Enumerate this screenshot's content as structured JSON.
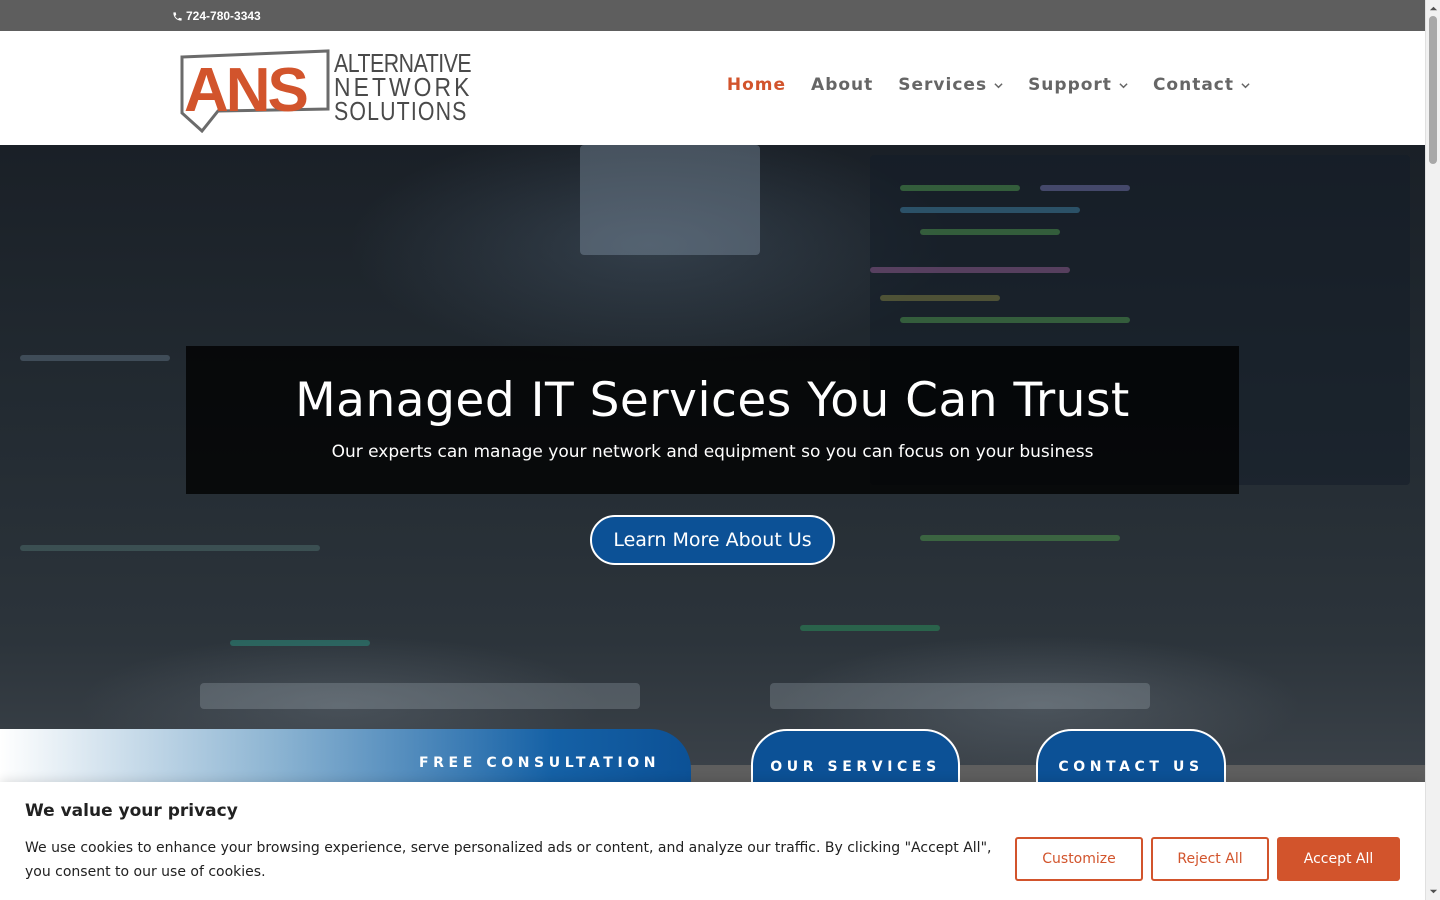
{
  "topbar": {
    "phone": "724-780-3343",
    "icon": "phone-icon"
  },
  "logo": {
    "mark": "ANS",
    "line1": "ALTERNATIVE",
    "line2": "NETWORK",
    "line3": "SOLUTIONS"
  },
  "nav": {
    "items": [
      {
        "label": "Home",
        "active": true,
        "has_dropdown": false
      },
      {
        "label": "About",
        "active": false,
        "has_dropdown": false
      },
      {
        "label": "Services",
        "active": false,
        "has_dropdown": true
      },
      {
        "label": "Support",
        "active": false,
        "has_dropdown": true
      },
      {
        "label": "Contact",
        "active": false,
        "has_dropdown": true
      }
    ]
  },
  "hero": {
    "title": "Managed IT Services You Can Trust",
    "subtitle": "Our experts can manage your network and equipment so you can focus on your business",
    "button": "Learn More About Us"
  },
  "cta": {
    "free": "FREE CONSULTATION",
    "services": "OUR SERVICES",
    "contact": "CONTACT US"
  },
  "cookie": {
    "title": "We value your privacy",
    "text": "We use cookies to enhance your browsing experience, serve personalized ads or content, and analyze our traffic. By clicking \"Accept All\", you consent to our use of cookies.",
    "customize": "Customize",
    "reject": "Reject All",
    "accept": "Accept All"
  },
  "colors": {
    "accent": "#d2542c",
    "primary_blue": "#0c5196",
    "topbar": "#5e5e5e",
    "nav_text": "#666666"
  }
}
